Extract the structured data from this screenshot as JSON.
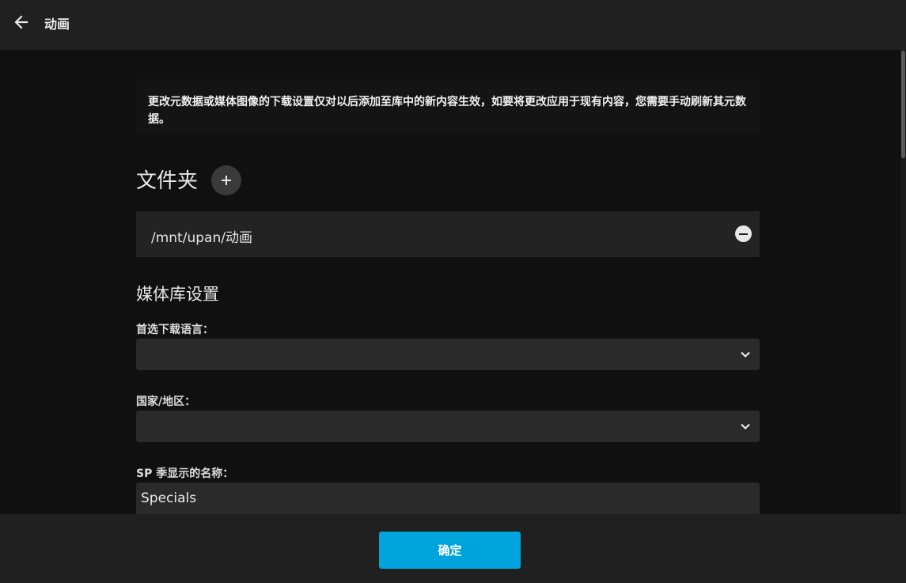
{
  "header": {
    "title": "动画",
    "back_icon": "arrow-left-icon"
  },
  "notice": {
    "text": "更改元数据或媒体图像的下载设置仅对以后添加至库中的新内容生效，如要将更改应用于现有内容，您需要手动刷新其元数据。"
  },
  "folders": {
    "title": "文件夹",
    "add_icon": "plus-icon",
    "items": [
      {
        "path": "/mnt/upan/动画",
        "remove_icon": "minus-circle-icon"
      }
    ]
  },
  "library_settings": {
    "title": "媒体库设置",
    "language": {
      "label": "首选下载语言：",
      "value": ""
    },
    "country": {
      "label": "国家/地区：",
      "value": ""
    },
    "specials": {
      "label": "SP 季显示的名称：",
      "value": "Specials"
    }
  },
  "footer": {
    "ok_label": "确定"
  },
  "colors": {
    "accent": "#00a4dc",
    "header_bg": "#202020",
    "page_bg": "#101010",
    "field_bg": "#2a2a2a"
  }
}
